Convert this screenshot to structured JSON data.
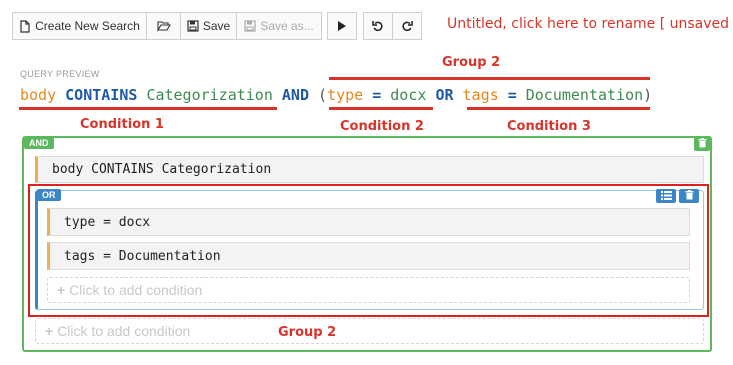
{
  "toolbar": {
    "create_new_search": "Create New Search",
    "save": "Save",
    "save_as": "Save as...",
    "icons": [
      "file-icon",
      "folder-open-icon",
      "save-icon",
      "save-as-icon",
      "play-icon",
      "undo-icon",
      "redo-icon"
    ]
  },
  "search_title": "Untitled, click here to rename [ unsaved ]",
  "query_preview": {
    "label": "QUERY PREVIEW",
    "c1_field": "body",
    "c1_op": "CONTAINS",
    "c1_value": "Categorization",
    "and": "AND",
    "open_paren": "(",
    "c2_field": "type",
    "c2_op": "=",
    "c2_value": "docx",
    "or": "OR",
    "c3_field": "tags",
    "c3_op": "=",
    "c3_value": "Documentation",
    "close_paren": ")"
  },
  "annotations": {
    "group2_top": "Group 2",
    "condition1": "Condition 1",
    "condition2": "Condition 2",
    "condition3": "Condition 3",
    "group2_bottom": "Group 2",
    "color": "#d9342b"
  },
  "builder": {
    "root_operator": "AND",
    "condition1": "body CONTAINS Categorization",
    "subgroup_operator": "OR",
    "condition2": "type = docx",
    "condition3": "tags = Documentation",
    "add_condition": "Click to add condition",
    "colors": {
      "and": "#5cb85c",
      "or": "#3a86c8",
      "delete": "#5cb85c",
      "condition_accent": "#f0ad4e"
    }
  }
}
